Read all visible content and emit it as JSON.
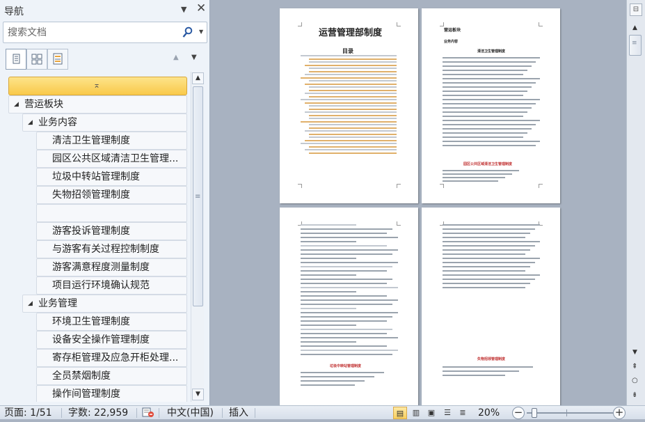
{
  "nav": {
    "title": "导航",
    "search_placeholder": "搜索文档",
    "tree": [
      {
        "label": "营运板块",
        "level": 0,
        "expanded": true
      },
      {
        "label": "业务内容",
        "level": 1,
        "expanded": true
      },
      {
        "label": "清洁卫生管理制度",
        "level": 2
      },
      {
        "label": "园区公共区域清洁卫生管理...",
        "level": 2
      },
      {
        "label": "垃圾中转站管理制度",
        "level": 2
      },
      {
        "label": "失物招领管理制度",
        "level": 2
      },
      {
        "label": "",
        "level": 2
      },
      {
        "label": "游客投诉管理制度",
        "level": 2
      },
      {
        "label": "与游客有关过程控制制度",
        "level": 2
      },
      {
        "label": "游客满意程度测量制度",
        "level": 2
      },
      {
        "label": "项目运行环境确认规范",
        "level": 2
      },
      {
        "label": "业务管理",
        "level": 1,
        "expanded": true
      },
      {
        "label": "环境卫生管理制度",
        "level": 2
      },
      {
        "label": "设备安全操作管理制度",
        "level": 2
      },
      {
        "label": "寄存柜管理及应急开柜处理...",
        "level": 2
      },
      {
        "label": "全员禁烟制度",
        "level": 2
      },
      {
        "label": "操作间管理制度",
        "level": 2
      }
    ]
  },
  "document": {
    "page1_title": "运营管理部制度",
    "toc_title": "目录",
    "page2_heading": "营运板块",
    "page2_subheading": "业务内容",
    "page2_section": "清洁卫生管理制度",
    "page2_section2": "园区公共区域清洁卫生管理制度",
    "page3_section": "垃圾中转站管理制度",
    "page4_section": "失物招领管理制度"
  },
  "status": {
    "page": "页面: 1/51",
    "words": "字数: 22,959",
    "language": "中文(中国)",
    "insert_mode": "插入",
    "zoom": "20%"
  },
  "colors": {
    "accent_selected": "#f9c94a",
    "nav_bg": "#eef3f9",
    "doc_bg": "#a8b2c1"
  },
  "icons": {
    "search": "magnifier",
    "close": "x",
    "pane_menu": "triangle-down"
  }
}
